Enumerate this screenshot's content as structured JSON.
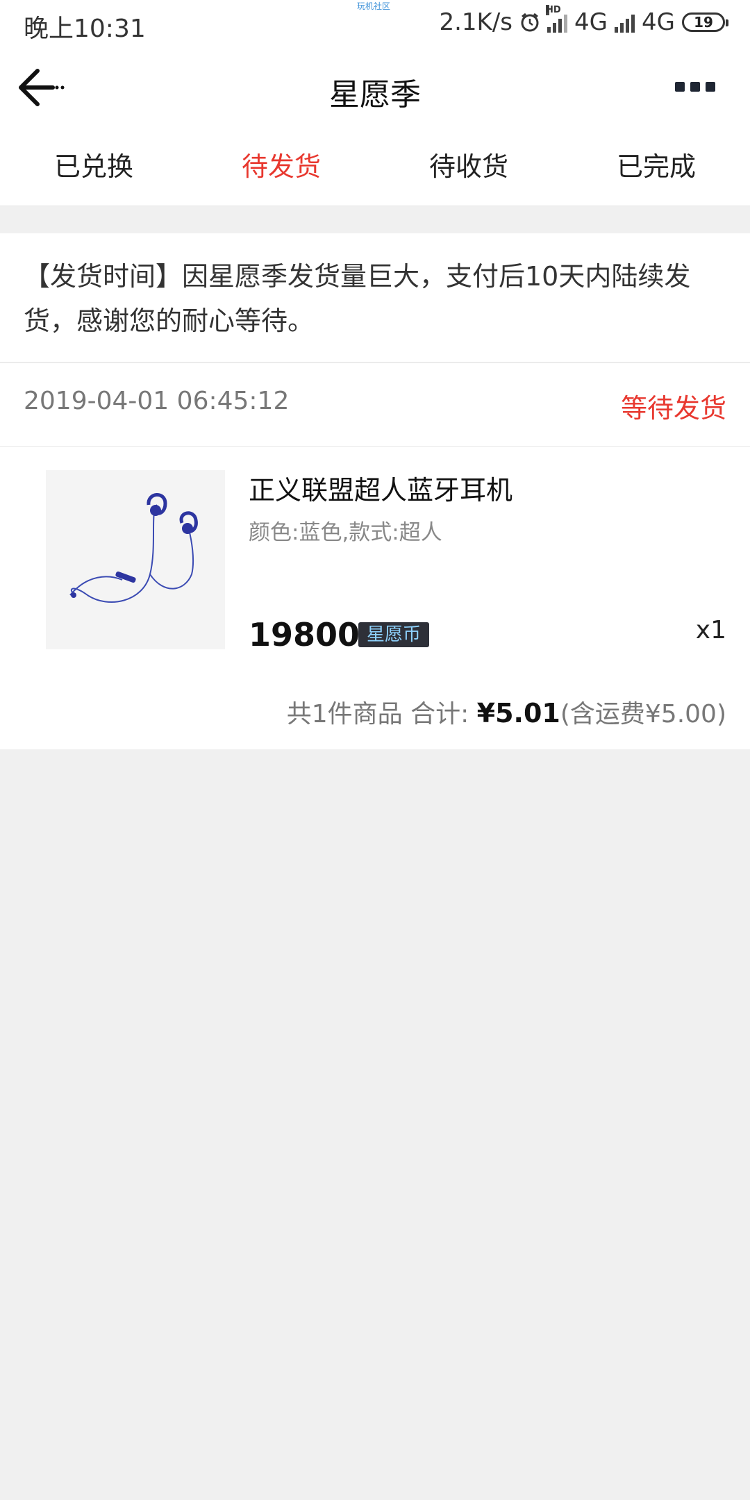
{
  "status_bar": {
    "time": "晚上10:31",
    "watermark": "玩机社区",
    "net_speed": "2.1K/s",
    "hd_label": "HD",
    "network1": "4G",
    "network2": "4G",
    "battery": "19"
  },
  "header": {
    "title": "星愿季"
  },
  "tabs": [
    {
      "label": "已兑换"
    },
    {
      "label": "待发货"
    },
    {
      "label": "待收货"
    },
    {
      "label": "已完成"
    }
  ],
  "notice": {
    "text": "【发货时间】因星愿季发货量巨大，支付后10天内陆续发货，感谢您的耐心等待。"
  },
  "order": {
    "time": "2019-04-01 06:45:12",
    "status": "等待发货",
    "product": {
      "name": "正义联盟超人蓝牙耳机",
      "spec": "颜色:蓝色,款式:超人",
      "price": "19800",
      "currency_badge": "星愿币",
      "quantity": "x1"
    },
    "summary": {
      "prefix": "共1件商品 合计: ",
      "total": "¥5.01",
      "shipping": "(含运费¥5.00)"
    }
  },
  "colors": {
    "accent": "#e8382f",
    "background": "#f0f0f0",
    "badge_bg": "#2e3038",
    "badge_text": "#8fd3ff"
  }
}
